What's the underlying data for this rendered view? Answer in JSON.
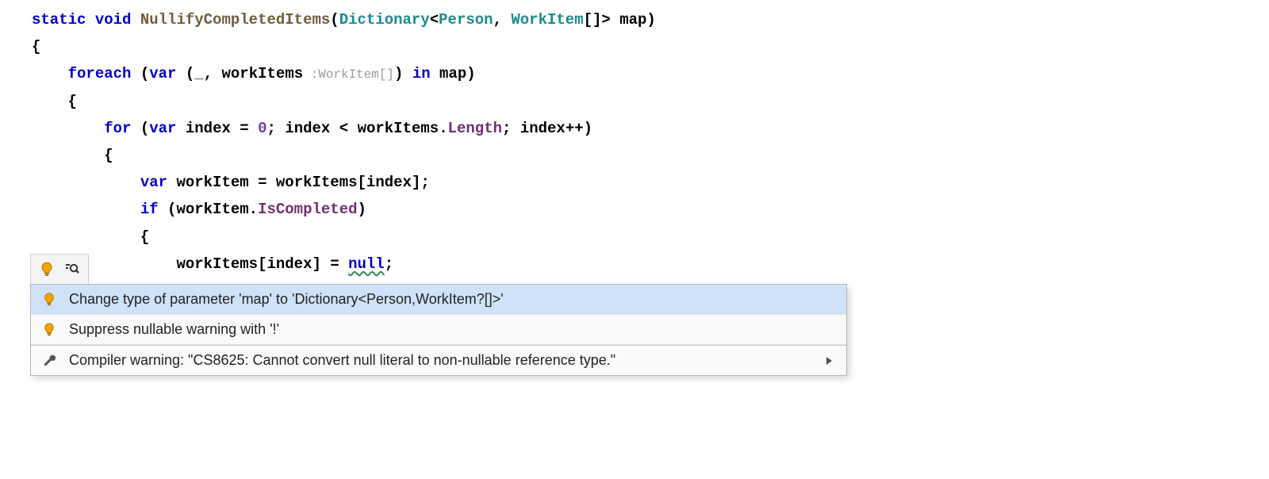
{
  "code": {
    "l1": {
      "kw1": "static",
      "kw2": "void",
      "method": "NullifyCompletedItems",
      "p1": "(",
      "type1": "Dictionary",
      "lt": "<",
      "type2": "Person",
      "comma": ", ",
      "type3": "WorkItem",
      "arr": "[]> ",
      "param": "map",
      "p2": ")"
    },
    "l2": "{",
    "l3": {
      "indent": "    ",
      "kw": "foreach",
      "p1": " (",
      "var": "var",
      "p2": " (",
      "discard": "_",
      "comma": ", ",
      "id": "workItems",
      "hint": " :WorkItem[]",
      "p3": ") ",
      "in": "in",
      "sp": " ",
      "map": "map",
      "p4": ")"
    },
    "l4": "    {",
    "l5": {
      "indent": "        ",
      "kw": "for",
      "p1": " (",
      "var": "var",
      "sp1": " ",
      "idx": "index",
      "eq": " = ",
      "zero": "0",
      "semi1": "; ",
      "idx2": "index",
      "lt": " < ",
      "wi": "workItems",
      "dot": ".",
      "len": "Length",
      "semi2": "; ",
      "idx3": "index",
      "pp": "++)",
      "end": ""
    },
    "l6": "        {",
    "l7": {
      "indent": "            ",
      "var": "var",
      "sp": " ",
      "wi": "workItem",
      "eq": " = ",
      "wis": "workItems",
      "br1": "[",
      "idx": "index",
      "br2": "];"
    },
    "l8": {
      "indent": "            ",
      "kw": "if",
      "p1": " (",
      "wi": "workItem",
      "dot": ".",
      "prop": "IsCompleted",
      "p2": ")"
    },
    "l9": "            {",
    "l10": {
      "indent": "                ",
      "wis": "workItems",
      "br1": "[",
      "idx": "index",
      "br2": "] = ",
      "null": "null",
      "semi": ";"
    }
  },
  "popup": {
    "item1": "Change type of parameter 'map' to 'Dictionary<Person,WorkItem?[]>'",
    "item2": "Suppress nullable warning with '!'",
    "item3": "Compiler warning: \"CS8625: Cannot convert null literal to non-nullable reference type.\""
  }
}
